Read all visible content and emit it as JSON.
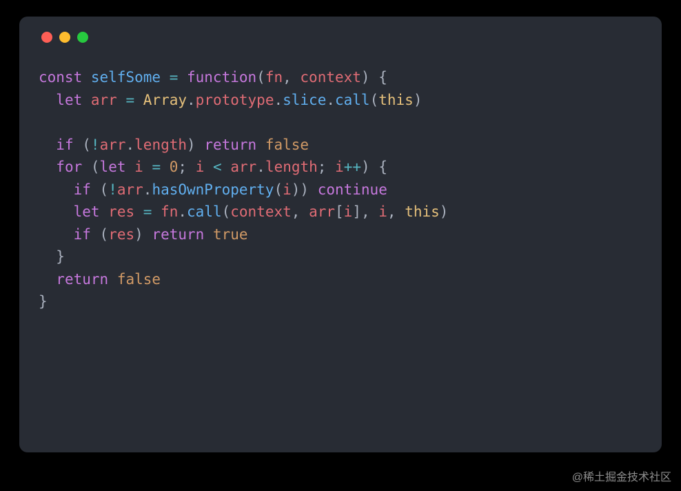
{
  "window": {
    "lights": [
      "red",
      "yellow",
      "green"
    ]
  },
  "code": {
    "l1": {
      "const": "const",
      "name": "selfSome",
      "eq": "=",
      "function": "function",
      "p1": "fn",
      "p2": "context"
    },
    "l2": {
      "let": "let",
      "v": "arr",
      "eq": "=",
      "Array": "Array",
      "prototype": "prototype",
      "slice": "slice",
      "call": "call",
      "this": "this"
    },
    "l4": {
      "if": "if",
      "bang": "!",
      "arr": "arr",
      "length": "length",
      "return": "return",
      "false": "false"
    },
    "l5": {
      "for": "for",
      "let": "let",
      "i": "i",
      "eq": "=",
      "zero": "0",
      "lt": "<",
      "arr": "arr",
      "length": "length",
      "pp": "++"
    },
    "l6": {
      "if": "if",
      "bang": "!",
      "arr": "arr",
      "hasOwnProperty": "hasOwnProperty",
      "i": "i",
      "continue": "continue"
    },
    "l7": {
      "let": "let",
      "res": "res",
      "eq": "=",
      "fn": "fn",
      "call": "call",
      "context": "context",
      "arr": "arr",
      "i": "i",
      "this": "this"
    },
    "l8": {
      "if": "if",
      "res": "res",
      "return": "return",
      "true": "true"
    },
    "l10": {
      "return": "return",
      "false": "false"
    }
  },
  "watermark": "@稀土掘金技术社区"
}
